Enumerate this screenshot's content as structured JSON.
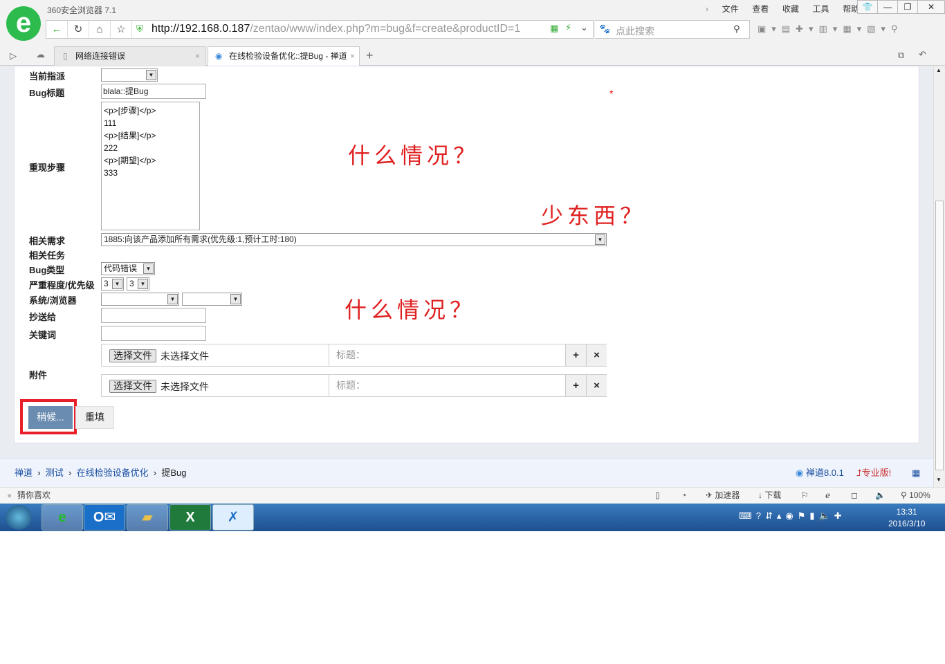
{
  "browser": {
    "title": "360安全浏览器 7.1",
    "menu": [
      "文件",
      "查看",
      "收藏",
      "工具",
      "帮助"
    ],
    "url_host": "http://192.168.0.187",
    "url_path": "/zentao/www/index.php?m=bug&f=create&productID=1",
    "search_placeholder": "点此搜索",
    "tabs": [
      {
        "label": "网络连接错误"
      },
      {
        "label": "在线检验设备优化::提Bug - 禅道"
      }
    ]
  },
  "form": {
    "assigned_label": "当前指派",
    "assigned_value": "",
    "title_label": "Bug标题",
    "title_value": "blala::提Bug",
    "steps_label": "重现步骤",
    "steps_value": "<p>[步骤]</p>\n111\n<p>[结果]</p>\n222\n<p>[期望]</p>\n333",
    "story_label": "相关需求",
    "story_value": "1885:向该产品添加所有需求(优先级:1,预计工时:180)",
    "task_label": "相关任务",
    "type_label": "Bug类型",
    "type_value": "代码错误",
    "severity_label": "严重程度/优先级",
    "severity_value": "3",
    "priority_value": "3",
    "os_label": "系统/浏览器",
    "os_value": "",
    "browser_value": "",
    "mailto_label": "抄送给",
    "keywords_label": "关键词",
    "files_label": "附件",
    "choose_file": "选择文件",
    "no_file": "未选择文件",
    "file_title_placeholder": "标题：",
    "add": "+",
    "remove": "×",
    "required_mark": "*",
    "submit_label": "稍候...",
    "reset_label": "重填"
  },
  "annotations": [
    "什么情况？",
    "少东西？",
    "什么情况？"
  ],
  "footer": {
    "breadcrumb": [
      "禅道",
      "测试",
      "在线检验设备优化",
      "提Bug"
    ],
    "version": "禅道8.0.1",
    "pro": "专业版!"
  },
  "statusbar": {
    "left": "猜你喜欢",
    "accelerator": "加速器",
    "download": "下载",
    "zoom": "100%"
  },
  "taskbar": {
    "time": "13:31",
    "date": "2016/3/10"
  }
}
